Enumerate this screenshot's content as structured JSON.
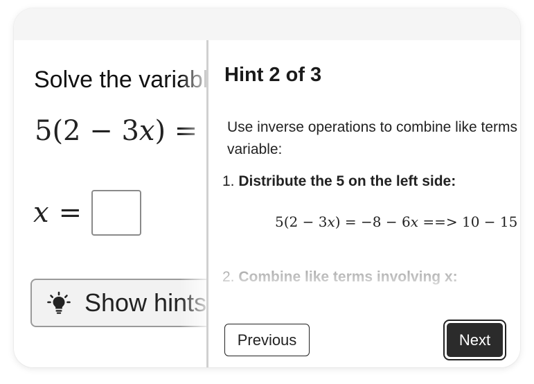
{
  "exercise": {
    "question": "Solve the variable",
    "equation": {
      "lhs_coef": "5",
      "lhs_open": "(2 − 3",
      "lhs_var": "x",
      "lhs_close": ")",
      "equals": "="
    },
    "answer": {
      "var": "x",
      "equals": "=",
      "value": ""
    },
    "show_hints_label": "Show hints"
  },
  "hint": {
    "title": "Hint 2 of 3",
    "intro_line1": "Use inverse operations to combine like terms involving the",
    "intro_line2": "variable:",
    "step1_num": "1.",
    "step1_text": "Distribute the 5 on the left side:",
    "math": {
      "part1": "5(2 − 3",
      "var1": "x",
      "part2": ") = −8 − 6",
      "var2": "x",
      "part3": " ==> 10 − 15"
    },
    "step2_num": "2.",
    "step2_text": "Combine like terms involving x:",
    "prev_label": "Previous",
    "next_label": "Next"
  },
  "icons": {
    "show_hints": "lightbulb-icon"
  },
  "colors": {
    "next_button_bg": "#2b2b2b",
    "divider": "#d0d0d0",
    "topbar": "#f5f5f5"
  }
}
